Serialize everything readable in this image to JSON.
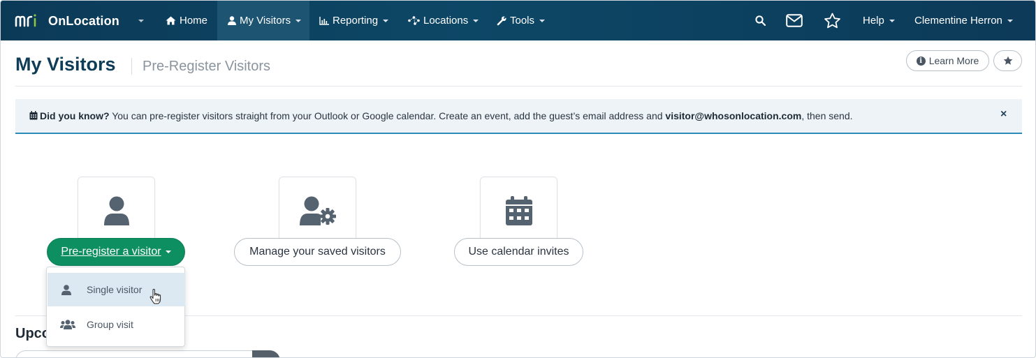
{
  "nav": {
    "brand_logo_text": "mri",
    "brand_name": "OnLocation",
    "home": "Home",
    "my_visitors": "My Visitors",
    "reporting": "Reporting",
    "locations": "Locations",
    "tools": "Tools",
    "help": "Help",
    "user": "Clementine Herron",
    "icons": [
      "home-icon",
      "user-icon",
      "chart-icon",
      "network-icon",
      "wrench-icon",
      "search-icon",
      "mail-icon",
      "star-icon"
    ]
  },
  "header": {
    "title": "My Visitors",
    "subtitle": "Pre-Register Visitors",
    "learn_more": "Learn More"
  },
  "banner": {
    "lead": "Did you know?",
    "text_before": " You can pre-register visitors straight from your Outlook or Google calendar. Create an event, add the guest’s email address and ",
    "email": "visitor@whosonlocation.com",
    "text_after": ", then send.",
    "close": "×"
  },
  "actions": {
    "pre_register": "Pre-register a visitor",
    "manage_saved": "Manage your saved visitors",
    "calendar_invites": "Use calendar invites"
  },
  "dropdown": {
    "items": [
      {
        "label": "Single visitor",
        "icon": "user-icon",
        "hovered": true
      },
      {
        "label": "Group visit",
        "icon": "users-icon",
        "hovered": false
      }
    ]
  },
  "section": {
    "upcoming_partial": "Upco"
  },
  "colors": {
    "nav_bg": "#0d4766",
    "primary_green": "#0e8f62",
    "title_color": "#0f3d57",
    "banner_accent": "#2a8cb6",
    "hover_bg": "#dde9f2"
  }
}
